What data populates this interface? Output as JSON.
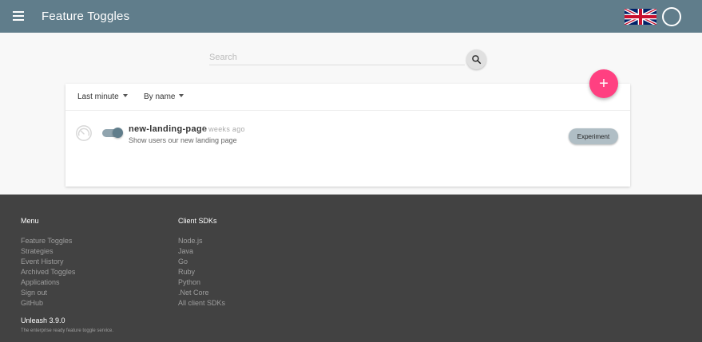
{
  "header": {
    "title": "Feature Toggles",
    "menu_icon": "hamburger-menu-icon",
    "flag_icon": "uk-flag-icon",
    "avatar_icon": "user-avatar-icon"
  },
  "search": {
    "placeholder": "Search",
    "value": "",
    "button_icon": "search-icon"
  },
  "filters": {
    "metric": "Last minute",
    "sort": "By name"
  },
  "add_button": {
    "label": "+"
  },
  "features": [
    {
      "name": "new-landing-page",
      "time": "3 weeks ago",
      "description": "Show users our new landing page",
      "enabled": true,
      "type": "Experiment"
    }
  ],
  "footer": {
    "menu_title": "Menu",
    "menu_items": [
      "Feature Toggles",
      "Strategies",
      "Event History",
      "Archived Toggles",
      "Applications",
      "Sign out",
      "GitHub"
    ],
    "sdk_title": "Client SDKs",
    "sdk_items": [
      "Node.js",
      "Java",
      "Go",
      "Ruby",
      "Python",
      ".Net Core",
      "All client SDKs"
    ],
    "version": "Unleash 3.9.0",
    "tagline": "The enterprise ready feature toggle service."
  },
  "colors": {
    "header": "#607d8b",
    "accent": "#ff4081",
    "footer": "#424242",
    "chip": "#b0bec5"
  }
}
